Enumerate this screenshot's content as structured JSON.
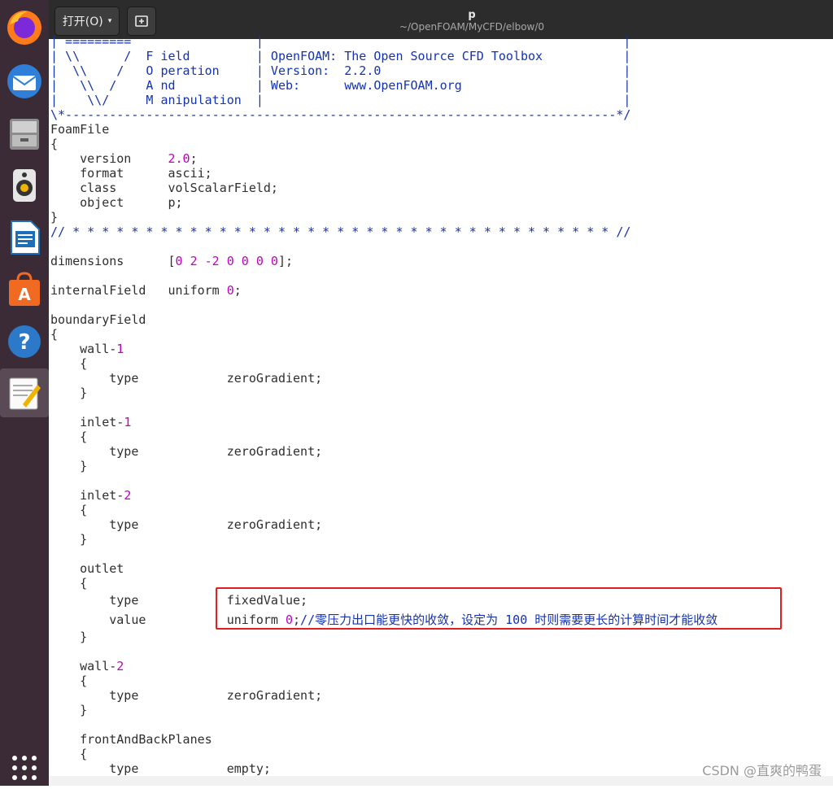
{
  "header": {
    "open_label": "打开(O)",
    "open_caret": "▾",
    "title": "p",
    "subtitle": "~/OpenFOAM/MyCFD/elbow/0"
  },
  "dock": {
    "items": [
      "firefox-icon",
      "thunderbird-icon",
      "files-icon",
      "rhythmbox-icon",
      "writer-icon",
      "software-icon",
      "help-icon",
      "text-editor-icon",
      "show-apps-icon"
    ]
  },
  "code": {
    "banner1": "| =========                 |                                                 |",
    "banner2": "| \\\\      /  F ield         | OpenFOAM: The Open Source CFD Toolbox           |",
    "banner3": "|  \\\\    /   O peration     | Version:  2.2.0                                 |",
    "banner4": "|   \\\\  /    A nd           | Web:      www.OpenFOAM.org                      |",
    "banner5": "|    \\\\/     M anipulation  |                                                 |",
    "banner6": "\\*---------------------------------------------------------------------------*/",
    "foamfile": "FoamFile",
    "ob": "{",
    "cb": "}",
    "version_key": "    version     ",
    "version_val": "2.0",
    "version_end": ";",
    "format_line": "    format      ascii;",
    "class_line": "    class       volScalarField;",
    "object_line": "    object      p;",
    "separator": "// * * * * * * * * * * * * * * * * * * * * * * * * * * * * * * * * * * * * * //",
    "dimensions_key": "dimensions      [",
    "dimensions_val": "0 2 -2 0 0 0 0",
    "dimensions_end": "];",
    "internal_key": "internalField   uniform ",
    "internal_val": "0",
    "internal_end": ";",
    "boundary": "boundaryField",
    "wall1_name": "    wall-",
    "wall1_num": "1",
    "inlet1_name": "    inlet-",
    "inlet1_num": "1",
    "inlet2_name": "    inlet-",
    "inlet2_num": "2",
    "outlet_name": "    outlet",
    "wall2_name": "    wall-",
    "wall2_num": "2",
    "fbp_name": "    frontAndBackPlanes",
    "inner_ob": "    {",
    "inner_cb": "    }",
    "type_zero": "        type            zeroGradient;",
    "type_fixed": "        type            fixedValue;",
    "value_key": "        value           uniform ",
    "value_num": "0",
    "value_semi": ";",
    "value_comment": "//零压力出口能更快的收敛，设定为 100 时则需要更长的计算时间才能收敛",
    "type_empty": "        type            empty;"
  },
  "watermark": "CSDN @直爽的鸭蛋"
}
